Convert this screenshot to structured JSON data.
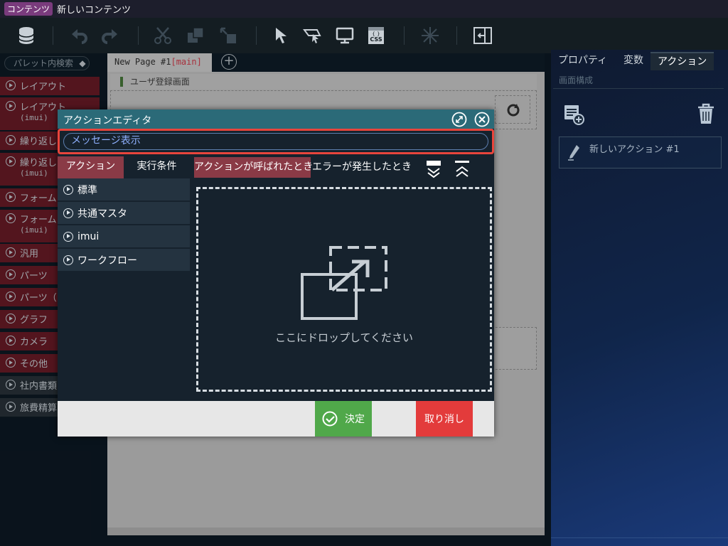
{
  "titlebar": {
    "badge": "コンテンツ",
    "title": "新しいコンテンツ"
  },
  "palette": {
    "search_placeholder": "パレット内検索",
    "items": [
      {
        "label": "レイアウト",
        "sub": "",
        "style": "red"
      },
      {
        "label": "レイアウト",
        "sub": "(imui)",
        "style": "red"
      },
      {
        "label": "繰り返し",
        "sub": "",
        "style": "red"
      },
      {
        "label": "繰り返し",
        "sub": "(imui)",
        "style": "red"
      },
      {
        "label": "フォーム",
        "sub": "",
        "style": "red"
      },
      {
        "label": "フォーム",
        "sub": "(imui)",
        "style": "red"
      },
      {
        "label": "汎用",
        "sub": "",
        "style": "red"
      },
      {
        "label": "パーツ",
        "sub": "",
        "style": "red"
      },
      {
        "label": "パーツ（",
        "sub": "",
        "style": "red"
      },
      {
        "label": "グラフ",
        "sub": "",
        "style": "red"
      },
      {
        "label": "カメラ",
        "sub": "",
        "style": "red"
      },
      {
        "label": "その他",
        "sub": "",
        "style": "red"
      },
      {
        "label": "社内書類",
        "sub": "",
        "style": "grey"
      },
      {
        "label": "旅費精算",
        "sub": "",
        "style": "grey"
      }
    ]
  },
  "canvas": {
    "page_tab": "New Page #1",
    "page_tab_main": "[main]",
    "header_title": "ユーザ登録画面"
  },
  "right_panel": {
    "tabs": [
      "プロパティ",
      "変数",
      "アクション"
    ],
    "active_tab": "アクション",
    "subheader": "画面構成",
    "action_item": "新しいアクション #1"
  },
  "dialog": {
    "title": "アクションエディタ",
    "name_value": "メッセージ表示",
    "left_tabs": [
      "アクション",
      "実行条件"
    ],
    "list": [
      "標準",
      "共通マスタ",
      "imui",
      "ワークフロー"
    ],
    "event_tabs": [
      "アクションが呼ばれたとき",
      "エラーが発生したとき"
    ],
    "drop_text": "ここにドロップしてください",
    "ok_label": "決定",
    "cancel_label": "取り消し"
  },
  "colors": {
    "accent_red": "#8a3a46",
    "dialog_header": "#2b6a78",
    "ok_green": "#50a84a",
    "cancel_red": "#e33b3b",
    "highlight": "#e8453c"
  }
}
